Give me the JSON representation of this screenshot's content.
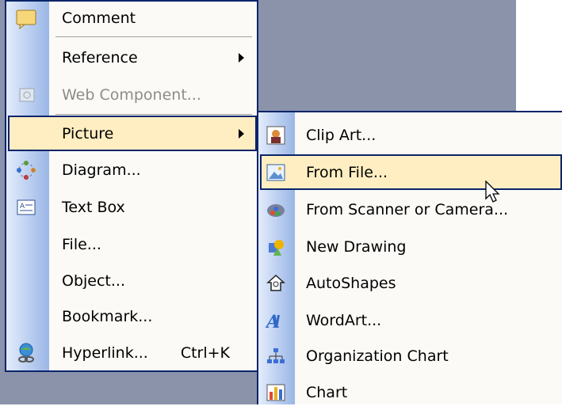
{
  "insert_menu": {
    "items": [
      {
        "label": "Comment",
        "icon": "comment-icon"
      },
      {
        "label": "Reference",
        "icon": "",
        "submenu": true
      },
      {
        "label": "Web Component...",
        "icon": "web-component-icon",
        "disabled": true
      },
      {
        "label": "Picture",
        "icon": "",
        "submenu": true,
        "highlighted": true
      },
      {
        "label": "Diagram...",
        "icon": "diagram-icon"
      },
      {
        "label": "Text Box",
        "icon": "text-box-icon"
      },
      {
        "label": "File...",
        "icon": ""
      },
      {
        "label": "Object...",
        "icon": ""
      },
      {
        "label": "Bookmark...",
        "icon": ""
      },
      {
        "label": "Hyperlink...",
        "shortcut": "Ctrl+K",
        "icon": "hyperlink-icon"
      }
    ]
  },
  "picture_submenu": {
    "items": [
      {
        "label": "Clip Art...",
        "icon": "clip-art-icon"
      },
      {
        "label": "From File...",
        "icon": "from-file-icon",
        "highlighted": true
      },
      {
        "label": "From Scanner or Camera...",
        "icon": "scanner-camera-icon"
      },
      {
        "label": "New Drawing",
        "icon": "new-drawing-icon"
      },
      {
        "label": "AutoShapes",
        "icon": "autoshapes-icon"
      },
      {
        "label": "WordArt...",
        "icon": "wordart-icon"
      },
      {
        "label": "Organization Chart",
        "icon": "organization-chart-icon"
      },
      {
        "label": "Chart",
        "icon": "chart-icon"
      }
    ]
  }
}
